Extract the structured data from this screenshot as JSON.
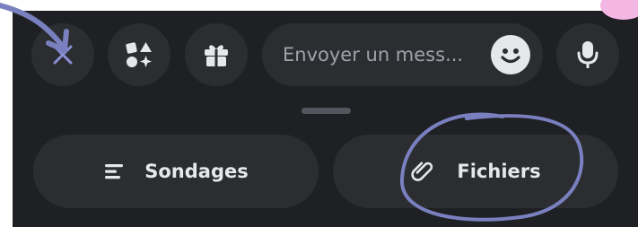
{
  "composer": {
    "close_icon": "close-icon",
    "apps_icon": "apps-icon",
    "gift_icon": "gift-icon",
    "message_placeholder": "Envoyer un mess...",
    "emoji_icon": "emoji-icon",
    "mic_icon": "microphone-icon"
  },
  "attachments": {
    "polls_label": "Sondages",
    "polls_icon": "list-icon",
    "files_label": "Fichiers",
    "files_icon": "paperclip-icon"
  },
  "colors": {
    "panel_bg": "#1f2023",
    "button_bg": "#2b2d31",
    "annotation": "#7a80bf"
  }
}
